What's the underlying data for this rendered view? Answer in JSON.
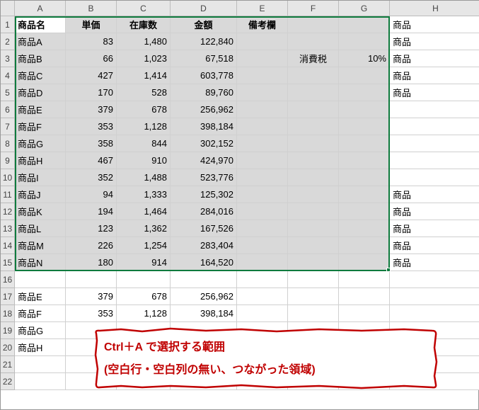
{
  "columns": [
    "A",
    "B",
    "C",
    "D",
    "E",
    "F",
    "G",
    "H"
  ],
  "rowCount": 22,
  "header": {
    "A": "商品名",
    "B": "単価",
    "C": "在庫数",
    "D": "金額",
    "E": "備考欄"
  },
  "selection": {
    "startRow": 1,
    "endRow": 15,
    "startCol": "A",
    "endCol": "G"
  },
  "tax": {
    "label": "消費税",
    "value": "10%"
  },
  "products": [
    {
      "name": "商品A",
      "price": "83",
      "stock": "1,480",
      "amount": "122,840"
    },
    {
      "name": "商品B",
      "price": "66",
      "stock": "1,023",
      "amount": "67,518"
    },
    {
      "name": "商品C",
      "price": "427",
      "stock": "1,414",
      "amount": "603,778"
    },
    {
      "name": "商品D",
      "price": "170",
      "stock": "528",
      "amount": "89,760"
    },
    {
      "name": "商品E",
      "price": "379",
      "stock": "678",
      "amount": "256,962"
    },
    {
      "name": "商品F",
      "price": "353",
      "stock": "1,128",
      "amount": "398,184"
    },
    {
      "name": "商品G",
      "price": "358",
      "stock": "844",
      "amount": "302,152"
    },
    {
      "name": "商品H",
      "price": "467",
      "stock": "910",
      "amount": "424,970"
    },
    {
      "name": "商品I",
      "price": "352",
      "stock": "1,488",
      "amount": "523,776"
    },
    {
      "name": "商品J",
      "price": "94",
      "stock": "1,333",
      "amount": "125,302"
    },
    {
      "name": "商品K",
      "price": "194",
      "stock": "1,464",
      "amount": "284,016"
    },
    {
      "name": "商品L",
      "price": "123",
      "stock": "1,362",
      "amount": "167,526"
    },
    {
      "name": "商品M",
      "price": "226",
      "stock": "1,254",
      "amount": "283,404"
    },
    {
      "name": "商品N",
      "price": "180",
      "stock": "914",
      "amount": "164,520"
    }
  ],
  "lowerRows": [
    {
      "name": "商品E",
      "price": "379",
      "stock": "678",
      "amount": "256,962"
    },
    {
      "name": "商品F",
      "price": "353",
      "stock": "1,128",
      "amount": "398,184"
    },
    {
      "name": "商品G",
      "price": "",
      "stock": "",
      "amount": ""
    },
    {
      "name": "商品H",
      "price": "",
      "stock": "",
      "amount": ""
    }
  ],
  "colH": {
    "1": "商品",
    "2": "商品",
    "3": "商品",
    "4": "商品",
    "5": "商品",
    "11": "商品",
    "12": "商品",
    "13": "商品",
    "14": "商品",
    "15": "商品"
  },
  "annotation": {
    "line1": "Ctrl＋A で選択する範囲",
    "line2": "(空白行・空白列の無い、つながった領域)"
  },
  "chart_data": {
    "type": "table",
    "title": "Excel Ctrl+A selection range example",
    "columns": [
      "商品名",
      "単価",
      "在庫数",
      "金額",
      "備考欄"
    ],
    "rows": [
      [
        "商品A",
        83,
        1480,
        122840,
        ""
      ],
      [
        "商品B",
        66,
        1023,
        67518,
        ""
      ],
      [
        "商品C",
        427,
        1414,
        603778,
        ""
      ],
      [
        "商品D",
        170,
        528,
        89760,
        ""
      ],
      [
        "商品E",
        379,
        678,
        256962,
        ""
      ],
      [
        "商品F",
        353,
        1128,
        398184,
        ""
      ],
      [
        "商品G",
        358,
        844,
        302152,
        ""
      ],
      [
        "商品H",
        467,
        910,
        424970,
        ""
      ],
      [
        "商品I",
        352,
        1488,
        523776,
        ""
      ],
      [
        "商品J",
        94,
        1333,
        125302,
        ""
      ],
      [
        "商品K",
        194,
        1464,
        284016,
        ""
      ],
      [
        "商品L",
        123,
        1362,
        167526,
        ""
      ],
      [
        "商品M",
        226,
        1254,
        283404,
        ""
      ],
      [
        "商品N",
        180,
        914,
        164520,
        ""
      ]
    ],
    "extra": {
      "消費税": "10%"
    }
  }
}
